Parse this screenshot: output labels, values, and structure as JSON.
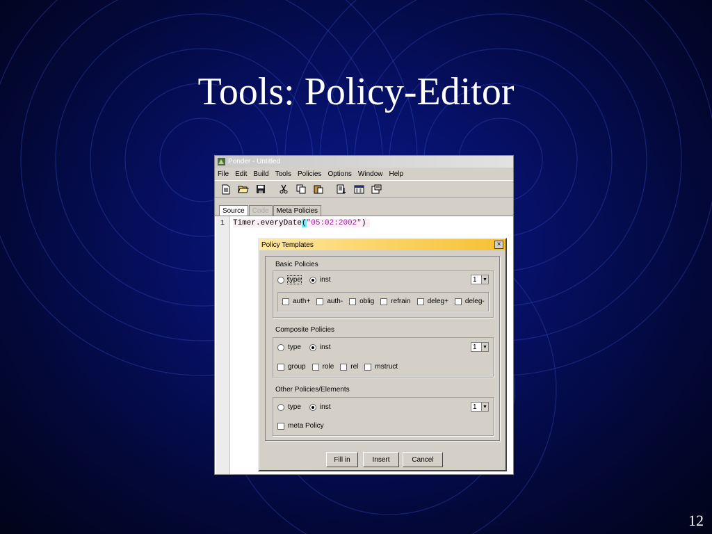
{
  "slide": {
    "title": "Tools: Policy-Editor",
    "number": "12"
  },
  "window": {
    "title": "Ponder - Untitled",
    "menu": [
      "File",
      "Edit",
      "Build",
      "Tools",
      "Policies",
      "Options",
      "Window",
      "Help"
    ],
    "toolbar_icons": [
      "new-file-icon",
      "open-folder-icon",
      "save-icon",
      "cut-icon",
      "copy-icon",
      "paste-icon",
      "compile-icon",
      "calendar-icon",
      "properties-icon"
    ],
    "tabs": [
      "Source",
      "Code",
      "Meta Policies"
    ],
    "active_tab": "Source",
    "disabled_tab": "Code"
  },
  "editor": {
    "line_number": "1",
    "code_prefix": "Timer.everyDate",
    "code_open_paren": "(",
    "code_string": "\"05:02:2002\"",
    "code_close_paren": ")"
  },
  "dialog": {
    "title": "Policy Templates",
    "close_label": "×",
    "basic": {
      "title": "Basic Policies",
      "radio_type": "type",
      "radio_inst": "inst",
      "selected": "inst",
      "count": "1",
      "checks": [
        "auth+",
        "auth-",
        "oblig",
        "refrain",
        "deleg+",
        "deleg-"
      ]
    },
    "composite": {
      "title": "Composite Policies",
      "radio_type": "type",
      "radio_inst": "inst",
      "selected": "inst",
      "count": "1",
      "checks": [
        "group",
        "role",
        "rel",
        "mstruct"
      ]
    },
    "other": {
      "title": "Other Policies/Elements",
      "radio_type": "type",
      "radio_inst": "inst",
      "selected": "inst",
      "count": "1",
      "checks": [
        "meta Policy"
      ]
    },
    "buttons": {
      "fill_in": "Fill in",
      "insert": "Insert",
      "cancel": "Cancel"
    }
  },
  "colors": {
    "background": "#061066",
    "dialog_title": "#f6c030",
    "paren_highlight": "#78e8f0",
    "string": "#a020a0"
  }
}
